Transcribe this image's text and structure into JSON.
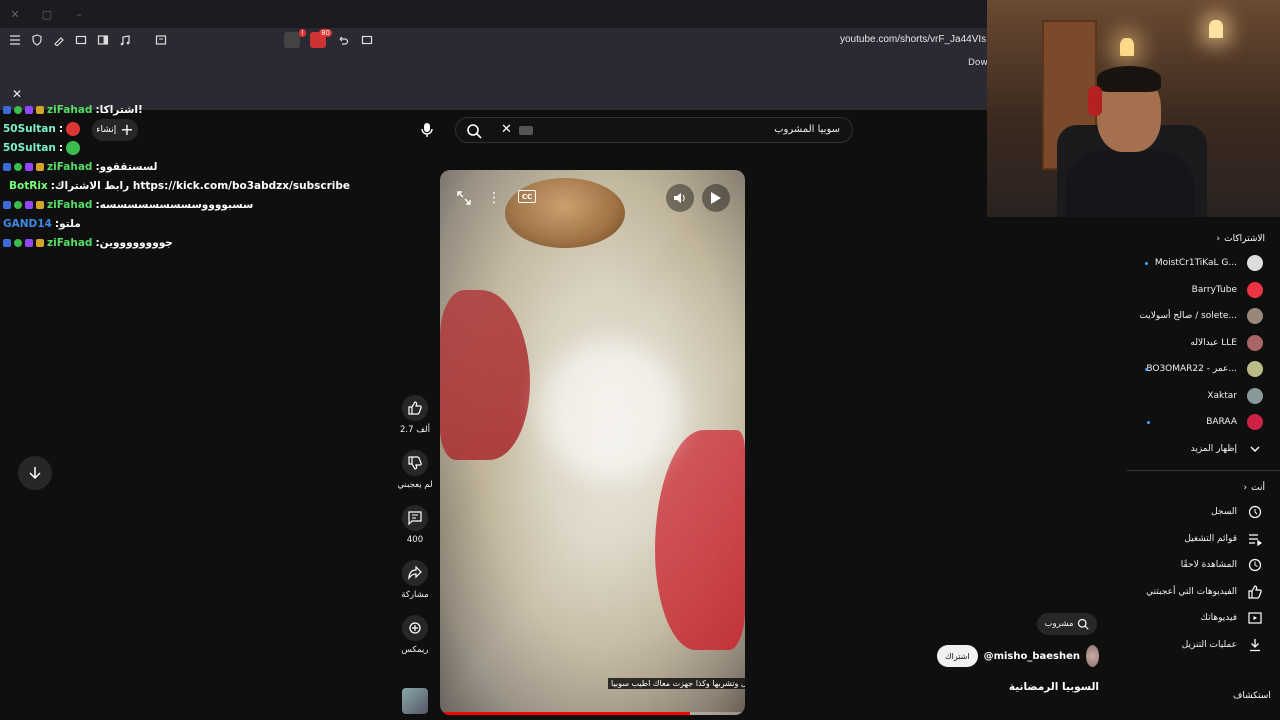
{
  "browser": {
    "url": "youtube.com/shorts/vrF_Ja44VIs",
    "ext_badge_count": "80",
    "download_label": "Dowr"
  },
  "chat": [
    {
      "user": "ziFahad",
      "sep": " : ",
      "msg": "اشتراكا!",
      "cls": "u-fahad",
      "badges": [
        "b-blue",
        "b-green",
        "b-purple",
        "b-gold"
      ]
    },
    {
      "user": "50Sultan",
      "sep": " : ",
      "msg": "",
      "cls": "u-sultan",
      "badges": [],
      "emote": "#d33"
    },
    {
      "user": "50Sultan",
      "sep": " : ",
      "msg": "",
      "cls": "u-sultan",
      "badges": [],
      "emote": "#3bbd4e"
    },
    {
      "user": "ziFahad",
      "sep": " : ",
      "msg": "لسستققوو",
      "cls": "u-fahad",
      "badges": [
        "b-blue",
        "b-green",
        "b-purple",
        "b-gold"
      ]
    },
    {
      "user": "BotRix",
      "sep": " : ",
      "msg": "رابط الاشتراك https://kick.com/bo3abdzx/subscribe",
      "cls": "u-botrix",
      "badges": [
        "b-blue",
        "b-green"
      ]
    },
    {
      "user": "ziFahad",
      "sep": " : ",
      "msg": "سسبووووسسسسسسسسسه",
      "cls": "u-fahad",
      "badges": [
        "b-blue",
        "b-green",
        "b-purple",
        "b-gold"
      ]
    },
    {
      "user": "GAND14",
      "sep": " : ",
      "msg": "ملتو",
      "cls": "u-gand",
      "badges": []
    },
    {
      "user": "ziFahad",
      "sep": " : ",
      "msg": "جووووووووين",
      "cls": "u-fahad",
      "badges": [
        "b-blue",
        "b-green",
        "b-purple",
        "b-gold"
      ]
    }
  ],
  "youtube": {
    "create_label": "إنشاء",
    "search_query": "سوبيا المشروب",
    "actions": {
      "like": "2.7 ألف",
      "dislike": "لم يعجبني",
      "comments": "400",
      "share": "مشاركة",
      "remix": "ريمكس"
    },
    "video": {
      "cc": "CC",
      "caption": "ل وتشربها وكذا جهزت معاك اطيب سوبيا",
      "progress": 0.82
    },
    "search_chip": "مشروب",
    "channel": "@misho_baeshen",
    "subscribe": "اشتراك",
    "title": "السوبيا الرمضانية"
  },
  "sidebar": {
    "subs_header": "الاشتراكات",
    "subs": [
      {
        "name": "MoistCr1TiKaL G...",
        "color": "#ddd",
        "dot": true
      },
      {
        "name": "BarryTube",
        "color": "#e34",
        "dot": false
      },
      {
        "name": "صالح أسولايت / solete...",
        "color": "#987",
        "dot": false
      },
      {
        "name": "عبدالاله LLE",
        "color": "#a66",
        "dot": false
      },
      {
        "name": "BO3OMAR22 - عمر...",
        "color": "#bb8",
        "dot": true
      },
      {
        "name": "Xaktar",
        "color": "#899",
        "dot": false
      },
      {
        "name": "BARAA",
        "color": "#c24",
        "dot": true
      }
    ],
    "show_more": "إظهار المزيد",
    "you_header": "أنت",
    "you": [
      {
        "name": "السجل",
        "icon": "history-icon"
      },
      {
        "name": "قوائم التشغيل",
        "icon": "playlist-icon"
      },
      {
        "name": "المشاهدة لاحقًا",
        "icon": "clock-icon"
      },
      {
        "name": "الفيديوهات التي أعجبتني",
        "icon": "like-icon"
      },
      {
        "name": "فيديوهاتك",
        "icon": "video-icon"
      },
      {
        "name": "عمليات التنزيل",
        "icon": "download-icon"
      }
    ],
    "explore": "استكشاف"
  }
}
